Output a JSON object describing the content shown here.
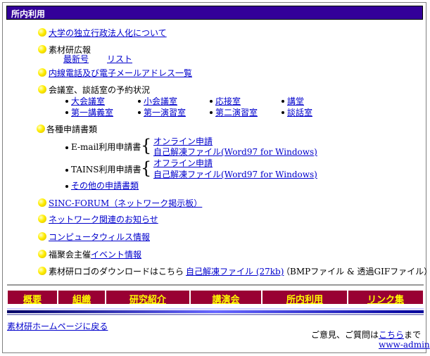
{
  "title": "所内利用",
  "items": {
    "independent_agency": "大学の独立行政法人化について",
    "newsletter": "素材研広報",
    "newsletter_latest": "最新号",
    "newsletter_list": "リスト",
    "directory": "内線電話及び電子メールアドレス一覧",
    "rooms": "会議室、談話室の予約状況",
    "room_links": [
      "大会議室",
      "小会議室",
      "応接室",
      "講堂",
      "第一講義室",
      "第一演習室",
      "第二演習室",
      "談話室"
    ],
    "forms": "各種申請書類",
    "email_form": "E-mail利用申請書",
    "tains_form": "TAINS利用申請書",
    "online_apply": "オンライン申請",
    "offline_apply": "オフライン申請",
    "self_extract_word": "自己解凍ファイル(Word97 for Windows)",
    "other_forms": "その他の申請書類",
    "sinc_forum": "SINC-FORUM（ネットワーク掲示板）",
    "network_news": "ネットワーク関連のお知らせ",
    "virus_info": "コンピュータウィルス情報",
    "event_prefix": "福聚会主催",
    "event_link": "イベント情報",
    "logo_prefix": "素材研ロゴのダウンロードはこちら",
    "logo_link": "自己解凍ファイル (27kb)",
    "logo_suffix": "（BMPファイル & 透過GIFファイル）"
  },
  "nav": [
    "概要",
    "組織",
    "研究紹介",
    "講演会",
    "所内利用",
    "リンク集"
  ],
  "footer": {
    "home_link": "素材研ホームページに戻る",
    "contact_prefix": "ご意見、ご質問は",
    "contact_link": "こちら",
    "contact_suffix": "まで",
    "admin_link": "www-admin"
  },
  "colors": {
    "title_bg": "#330099",
    "nav_bg": "#990033",
    "nav_text": "#ffff00",
    "link": "#0000cc"
  }
}
